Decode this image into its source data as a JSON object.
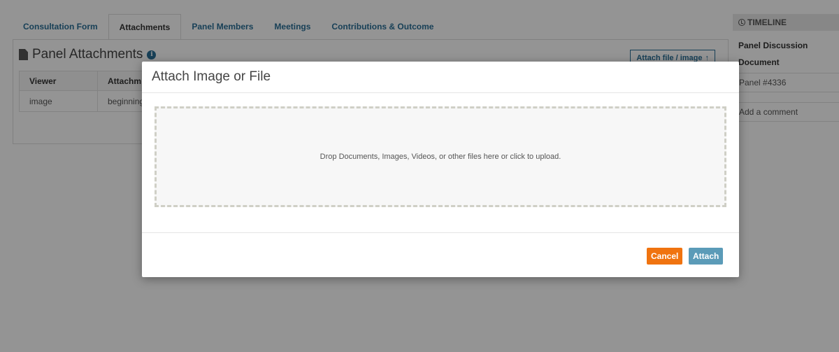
{
  "tabs": [
    {
      "label": "Consultation Form",
      "active": false
    },
    {
      "label": "Attachments",
      "active": true
    },
    {
      "label": "Panel Members",
      "active": false
    },
    {
      "label": "Meetings",
      "active": false
    },
    {
      "label": "Contributions & Outcome",
      "active": false
    }
  ],
  "panel": {
    "title": "Panel Attachments",
    "attach_button": "Attach file / image",
    "attach_icon": "upload-arrow-icon",
    "table": {
      "headers": [
        "Viewer",
        "Attachm"
      ],
      "rows": [
        [
          "image",
          "beginning"
        ]
      ]
    }
  },
  "timeline": {
    "header": "TIMELINE",
    "line1": "Panel Discussion",
    "line2": "Document",
    "panel_ref": "Panel #4336",
    "comment_placeholder": "Add a comment"
  },
  "modal": {
    "title": "Attach Image or File",
    "dropzone_text": "Drop Documents, Images, Videos, or other files here or click to upload.",
    "cancel_label": "Cancel",
    "attach_label": "Attach"
  },
  "colors": {
    "link_blue": "#2a6f97",
    "cancel_orange": "#f0730f",
    "attach_blue": "#5b9bb8"
  }
}
